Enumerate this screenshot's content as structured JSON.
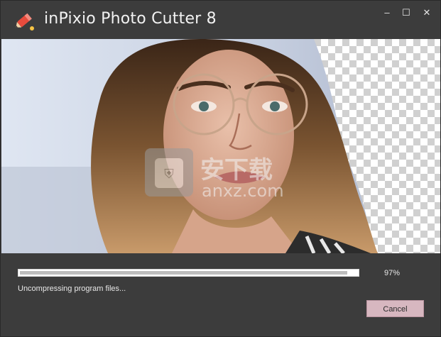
{
  "window": {
    "title": "inPixio Photo Cutter 8",
    "controls": {
      "minimize": "–",
      "maximize": "☐",
      "close": "✕"
    }
  },
  "hero": {
    "description_icon": "portrait-photo",
    "watermark_text": "anxz.com",
    "watermark_cjk": "安下载"
  },
  "install": {
    "progress_fraction": 0.97,
    "progress_label": "97%",
    "status_text": "Uncompressing program files...",
    "cancel_label": "Cancel"
  },
  "colors": {
    "window_bg": "#3c3c3c",
    "cancel_bg": "#d7b7c0",
    "progress_fill": "#bdbdbd"
  }
}
